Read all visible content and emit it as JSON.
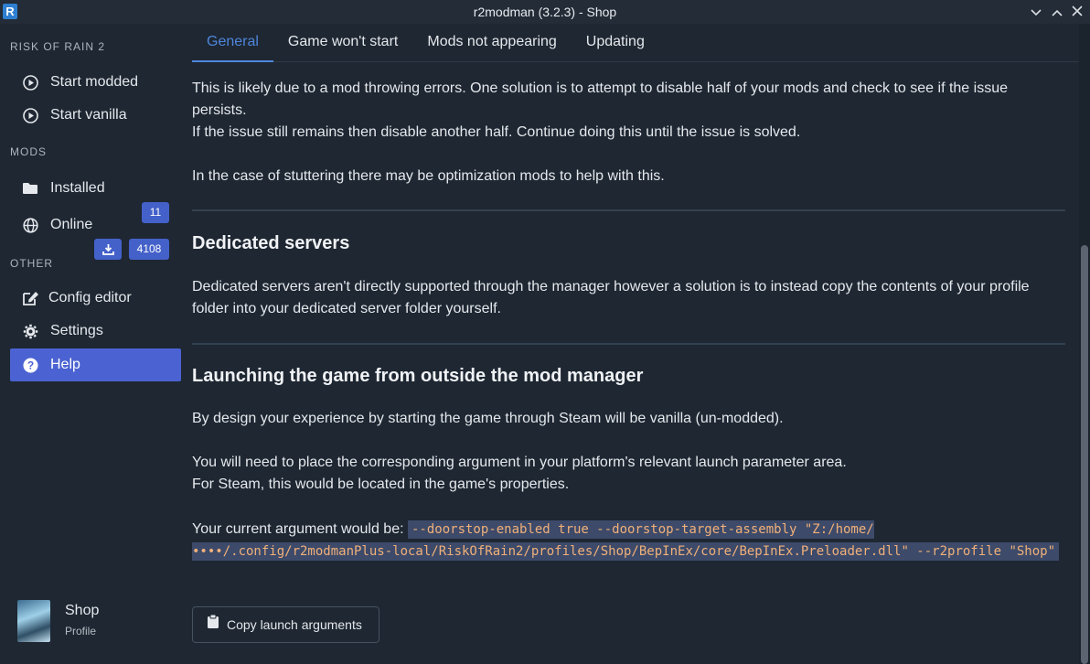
{
  "window": {
    "title": "r2modman (3.2.3) - Shop",
    "logo_letter": "R"
  },
  "sidebar": {
    "game_heading": "RISK OF RAIN 2",
    "start_modded": "Start modded",
    "start_vanilla": "Start vanilla",
    "mods_heading": "MODS",
    "installed": "Installed",
    "installed_count": "11",
    "online": "Online",
    "online_count": "4108",
    "other_heading": "OTHER",
    "config_editor": "Config editor",
    "settings": "Settings",
    "help": "Help",
    "profile_name": "Shop",
    "profile_label": "Profile"
  },
  "tabs": [
    "General",
    "Game won't start",
    "Mods not appearing",
    "Updating"
  ],
  "help": {
    "errors_p1": "This is likely due to a mod throwing errors. One solution is to attempt to disable half of your mods and check to see if the issue persists.",
    "errors_p2": "If the issue still remains then disable another half. Continue doing this until the issue is solved.",
    "stutter": "In the case of stuttering there may be optimization mods to help with this.",
    "dedicated_title": "Dedicated servers",
    "dedicated_text": "Dedicated servers aren't directly supported through the manager however a solution is to instead copy the contents of your profile folder into your dedicated server folder yourself.",
    "launch_title": "Launching the game from outside the mod manager",
    "launch_p1": "By design your experience by starting the game through Steam will be vanilla (un-modded).",
    "launch_p2": "You will need to place the corresponding argument in your platform's relevant launch parameter area.",
    "launch_p3": "For Steam, this would be located in the game's properties.",
    "argument_label": "Your current argument would be:",
    "argument_value": "--doorstop-enabled true --doorstop-target-assembly \"Z:/home/••••/.config/r2modmanPlus-local/RiskOfRain2/profiles/Shop/BepInEx/core/BepInEx.Preloader.dll\" --r2profile \"Shop\"",
    "copy_button": "Copy launch arguments"
  }
}
